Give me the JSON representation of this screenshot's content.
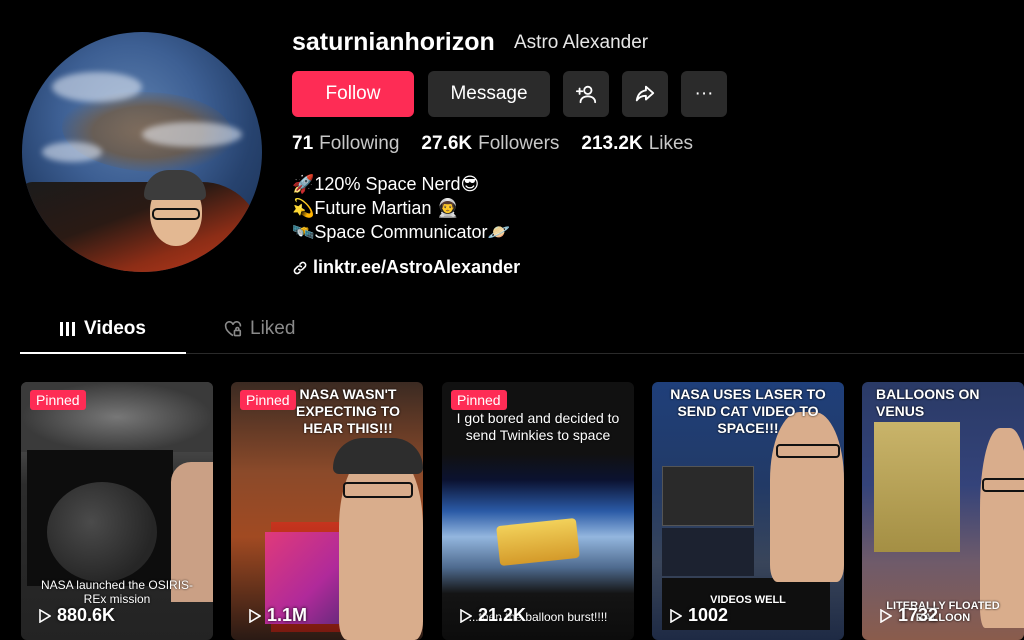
{
  "profile": {
    "username": "saturnianhorizon",
    "nickname": "Astro Alexander"
  },
  "actions": {
    "follow": "Follow",
    "message": "Message",
    "add_friend_icon": "add-user-icon",
    "share_icon": "share-icon",
    "more": "···"
  },
  "stats": [
    {
      "value": "71",
      "label": "Following"
    },
    {
      "value": "27.6K",
      "label": "Followers"
    },
    {
      "value": "213.2K",
      "label": "Likes"
    }
  ],
  "bio": [
    "🚀120% Space Nerd😎",
    "💫Future Martian 👨‍🚀",
    "🛰️Space Communicator🪐"
  ],
  "link": "linktr.ee/AstroAlexander",
  "tabs": {
    "videos": "Videos",
    "liked": "Liked"
  },
  "videos": [
    {
      "pinned": "Pinned",
      "title": "",
      "caption": "NASA launched the OSIRIS-REx mission",
      "views": "880.6K"
    },
    {
      "pinned": "Pinned",
      "title": "NASA WASN'T EXPECTING TO HEAR THIS!!!",
      "caption": "",
      "views": "1.1M"
    },
    {
      "pinned": "Pinned",
      "title": "I got bored and decided to send Twinkies to space",
      "caption": "...then the balloon burst!!!!",
      "views": "21.2K"
    },
    {
      "pinned": "",
      "title": "NASA USES LASER TO SEND CAT VIDEO TO SPACE!!!",
      "caption": "VIDEOS WELL",
      "views": "1002"
    },
    {
      "pinned": "",
      "title": "BALLOONS ON VENUS",
      "caption": "LITERALLY FLOATED BALLOON",
      "views": "1732"
    }
  ]
}
